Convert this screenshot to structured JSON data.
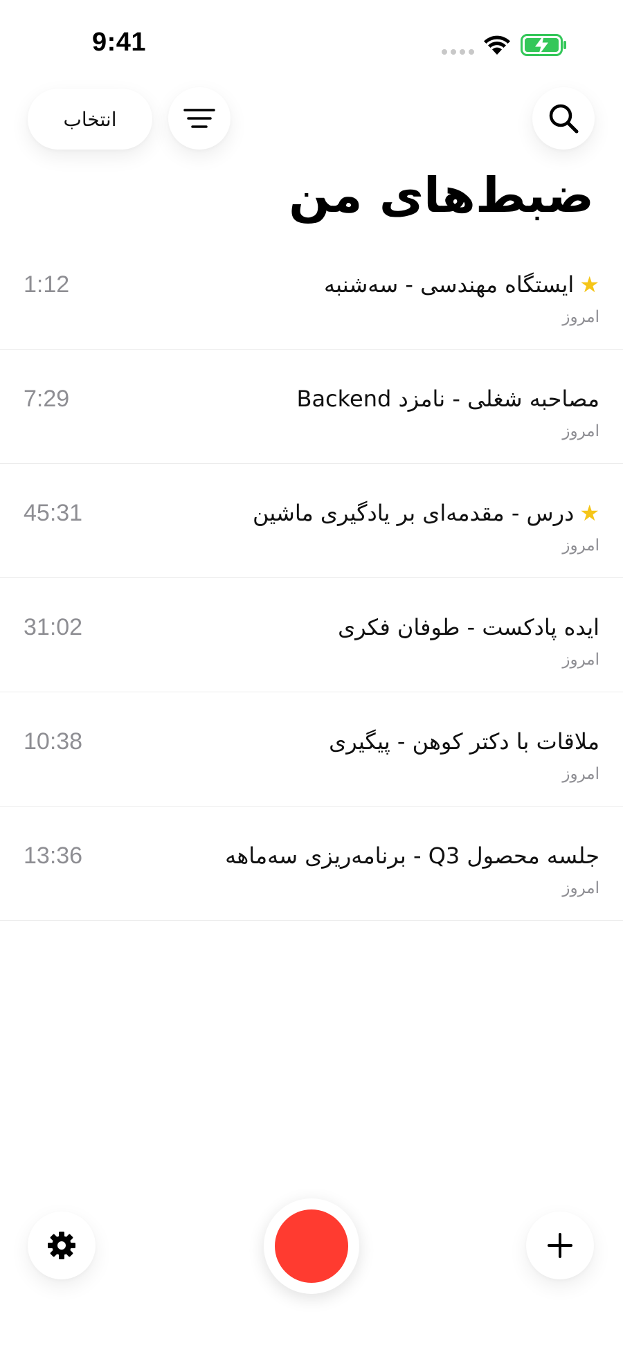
{
  "status_bar": {
    "time": "9:41"
  },
  "header": {
    "select_label": "انتخاب",
    "filter_icon": "filter-lines-icon",
    "search_icon": "search-icon",
    "title": "ضبط‌های من"
  },
  "recordings": [
    {
      "title": "ایستگاه مهندسی - سه‌شنبه",
      "date": "امروز",
      "duration": "1:12",
      "starred": true
    },
    {
      "title": "مصاحبه شغلی - نامزد Backend",
      "date": "امروز",
      "duration": "7:29",
      "starred": false
    },
    {
      "title": "درس - مقدمه‌ای بر یادگیری ماشین",
      "date": "امروز",
      "duration": "45:31",
      "starred": true
    },
    {
      "title": "ایده پادکست - طوفان فکری",
      "date": "امروز",
      "duration": "31:02",
      "starred": false
    },
    {
      "title": "ملاقات با دکتر کوهن - پیگیری",
      "date": "امروز",
      "duration": "10:38",
      "starred": false
    },
    {
      "title": "جلسه محصول Q3 - برنامه‌ریزی سه‌ماهه",
      "date": "امروز",
      "duration": "13:36",
      "starred": false
    }
  ],
  "bottom_bar": {
    "settings_icon": "gear-icon",
    "record_icon": "record-icon",
    "add_icon": "plus-icon"
  },
  "colors": {
    "record": "#ff3b30",
    "star": "#f5c518",
    "battery": "#34c759",
    "secondary_text": "#8e8e93"
  }
}
